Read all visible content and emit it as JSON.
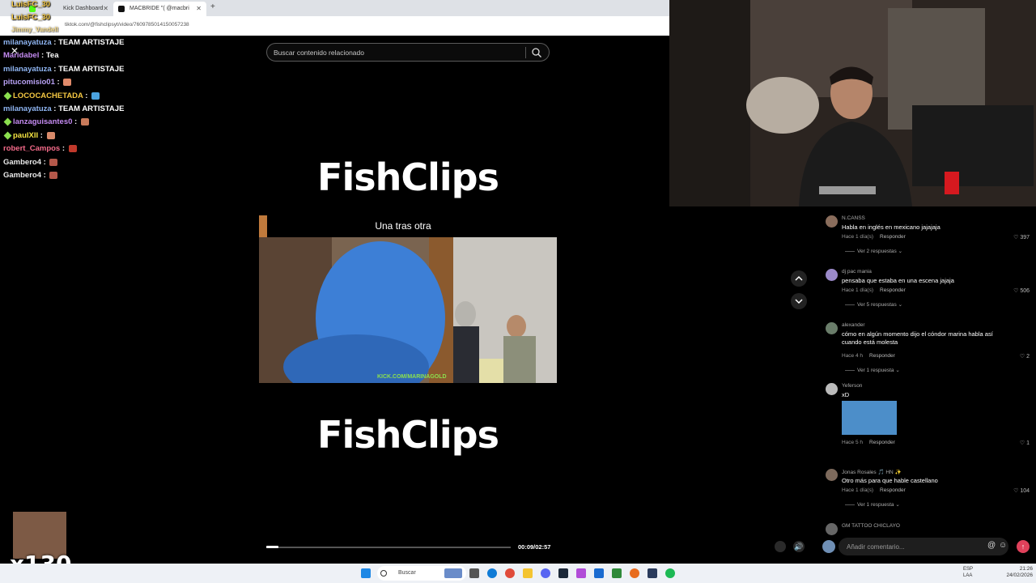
{
  "browser": {
    "tabs": [
      {
        "label": "Kick Dashboard"
      },
      {
        "label": "MACBRIDE \"( @macbri"
      }
    ],
    "url": "tiktok.com/@fishclipsyt/video/7609785014150057238",
    "overlay_user_top": "LuisFC_30",
    "overlay_user_mid": "LuisFC_30",
    "overlay_user_low": "Jimmy_Vandell"
  },
  "chat": [
    {
      "user": "milanayatuza",
      "text": "TEAM ARTISTAJE",
      "color": "#8fb5f2",
      "gem": false
    },
    {
      "user": "Maridabel",
      "text": "Tea",
      "color": "#c58bf2",
      "gem": false
    },
    {
      "user": "milanayatuza",
      "text": "TEAM ARTISTAJE",
      "color": "#8fb5f2",
      "gem": false
    },
    {
      "user": "pitucomisio01",
      "text": "",
      "color": "#b9a2f5",
      "gem": false
    },
    {
      "user": "LOCOCACHETADA",
      "text": "",
      "color": "#f5c842",
      "gem": true
    },
    {
      "user": "milanayatuza",
      "text": "TEAM ARTISTAJE",
      "color": "#8fb5f2",
      "gem": false
    },
    {
      "user": "lanzaguisantes0",
      "text": "",
      "color": "#c58bf2",
      "gem": true
    },
    {
      "user": "paulXII",
      "text": "",
      "color": "#f5e342",
      "gem": true
    },
    {
      "user": "robert_Campos",
      "text": "",
      "color": "#f56b8a",
      "gem": false
    },
    {
      "user": "Gambero4",
      "text": "",
      "color": "#e9e9e9",
      "gem": false
    },
    {
      "user": "Gambero4",
      "text": "",
      "color": "#e9e9e9",
      "gem": false
    }
  ],
  "video": {
    "search_placeholder": "Buscar contenido relacionado",
    "brand_top": "FishClips",
    "subtitle": "Una tras otra",
    "brand_bottom": "FishClips",
    "watermark": "KICK.COM/MARINAGOLD",
    "time": "00:09/02:57",
    "progress": 0.05
  },
  "comments": [
    {
      "name": "N.CANSS",
      "text": "Habla en inglés en mexicano jajajaja",
      "time": "Hace 1 día(s)",
      "reply": "Responder",
      "likes": "397",
      "replies": "Ver 2 respuestas"
    },
    {
      "name": "dj pac mania",
      "text": "pensaba que estaba en una escena jajaja",
      "time": "Hace 1 día(s)",
      "reply": "Responder",
      "likes": "506",
      "replies": "Ver 5 respuestas"
    },
    {
      "name": "alexander",
      "text": "cómo en algún momento dijo el cóndor marina habla así cuando está molesta",
      "time": "Hace 4 h",
      "reply": "Responder",
      "likes": "2",
      "replies": "Ver 1 respuesta"
    },
    {
      "name": "Yeferson",
      "text": "xD",
      "time": "Hace 5 h",
      "reply": "Responder",
      "likes": "1",
      "replies": ""
    },
    {
      "name": "Jonas Rosales 🎵 HN ✨",
      "text": "Otro más para que hable castellano",
      "time": "Hace 1 día(s)",
      "reply": "Responder",
      "likes": "104",
      "replies": "Ver 1 respuesta"
    },
    {
      "name": "GM TATTOO CHICLAYO",
      "text": "",
      "time": "",
      "reply": "",
      "likes": "",
      "replies": ""
    }
  ],
  "comment_input_placeholder": "Añadir comentario...",
  "sub_counter": "x130",
  "taskbar": {
    "search_label": "Buscar",
    "lang": "ESP\nLAA",
    "clock_time": "21:26",
    "clock_date": "24/02/2026"
  }
}
